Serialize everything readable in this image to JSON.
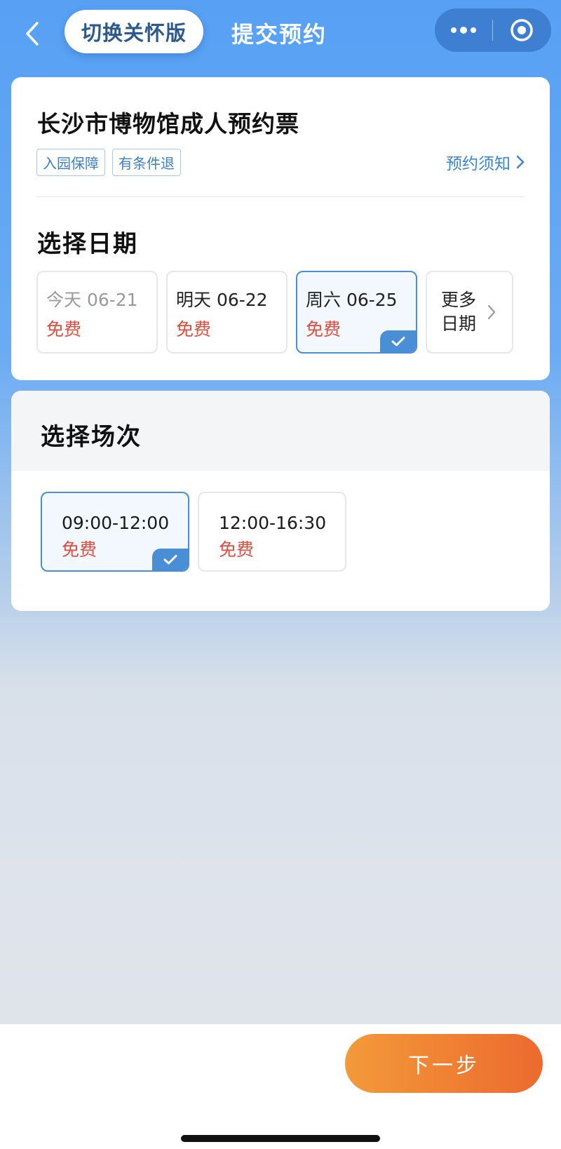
{
  "nav": {
    "care_label": "切换关怀版",
    "title": "提交预约",
    "back_icon": "chevron-left-icon",
    "more_icon": "more-dots-icon",
    "close_icon": "target-circle-icon"
  },
  "ticket": {
    "title": "长沙市博物馆成人预约票",
    "tags": [
      "入园保障",
      "有条件退"
    ],
    "notice_label": "预约须知"
  },
  "date_section": {
    "title": "选择日期",
    "dates": [
      {
        "label": "今天 06-21",
        "price": "免费",
        "state": "disabled"
      },
      {
        "label": "明天 06-22",
        "price": "免费",
        "state": "normal"
      },
      {
        "label": "周六 06-25",
        "price": "免费",
        "state": "selected"
      }
    ],
    "more_label": "更多日期"
  },
  "session_section": {
    "title": "选择场次",
    "sessions": [
      {
        "time": "09:00-12:00",
        "price": "免费",
        "state": "selected"
      },
      {
        "time": "12:00-16:30",
        "price": "免费",
        "state": "normal"
      }
    ]
  },
  "footer": {
    "next_label": "下一步"
  },
  "colors": {
    "header_blue": "#57a0f4",
    "selected_border": "#4a8fd6",
    "price_red": "#dc4e3f",
    "button_orange_start": "#f39a3a",
    "button_orange_end": "#ec6a2e"
  }
}
